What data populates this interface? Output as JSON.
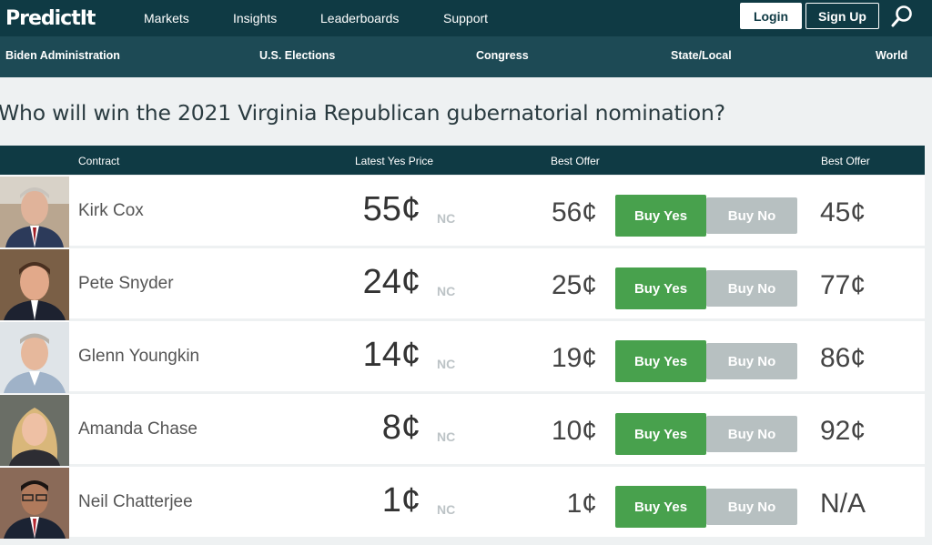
{
  "brand": {
    "logo_text": "PredictIt"
  },
  "nav": {
    "markets": "Markets",
    "insights": "Insights",
    "leaderboards": "Leaderboards",
    "support": "Support",
    "login": "Login",
    "signup": "Sign Up"
  },
  "subnav": {
    "biden": "Biden Administration",
    "us_elections": "U.S. Elections",
    "congress": "Congress",
    "state_local": "State/Local",
    "world": "World"
  },
  "page_title": "Who will win the 2021 Virginia Republican gubernatorial nomination?",
  "table": {
    "headers": {
      "contract": "Contract",
      "latest_yes_price": "Latest Yes Price",
      "best_offer_yes": "Best Offer",
      "best_offer_no": "Best Offer"
    },
    "buy_yes_label": "Buy Yes",
    "buy_no_label": "Buy No",
    "change_label": "NC",
    "rows": [
      {
        "name": "Kirk Cox",
        "latest": "55¢",
        "change": "NC",
        "best_yes": "56¢",
        "best_no": "45¢"
      },
      {
        "name": "Pete Snyder",
        "latest": "24¢",
        "change": "NC",
        "best_yes": "25¢",
        "best_no": "77¢"
      },
      {
        "name": "Glenn Youngkin",
        "latest": "14¢",
        "change": "NC",
        "best_yes": "19¢",
        "best_no": "86¢"
      },
      {
        "name": "Amanda Chase",
        "latest": "8¢",
        "change": "NC",
        "best_yes": "10¢",
        "best_no": "92¢"
      },
      {
        "name": "Neil Chatterjee",
        "latest": "1¢",
        "change": "NC",
        "best_yes": "1¢",
        "best_no": "N/A"
      }
    ]
  },
  "colors": {
    "header_bg": "#0f3a44",
    "subnav_bg": "#1d4a55",
    "buy_yes": "#48a14d",
    "buy_no": "#b7c0c1"
  }
}
